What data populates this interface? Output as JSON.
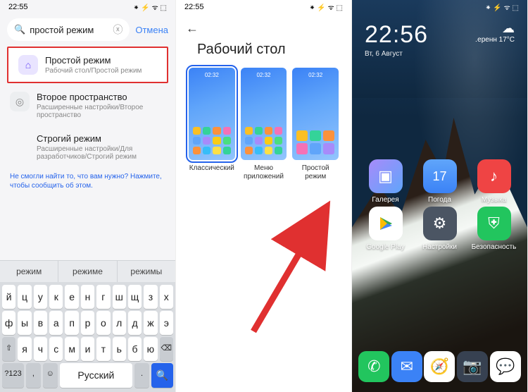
{
  "status": {
    "time": "22:55",
    "icons": "⁕ ⚡ ᯤ ⬚"
  },
  "screen1": {
    "search": {
      "icon": "🔍",
      "query": "простой режим",
      "clear": "ⓧ"
    },
    "cancel": "Отмена",
    "results": [
      {
        "icon": "⌂",
        "title": "Простой режим",
        "sub": "Рабочий стол/Простой режим"
      },
      {
        "icon": "◎",
        "title": "Второе пространство",
        "sub": "Расширенные настройки/Второе пространство"
      },
      {
        "icon": "",
        "title": "Строгий режим",
        "sub": "Расширенные настройки/Для разработчиков/Строгий режим"
      }
    ],
    "help": "Не смогли найти то, что вам нужно? Нажмите, чтобы сообщить об этом.",
    "suggestions": [
      "режим",
      "режиме",
      "режимы"
    ],
    "kbd": {
      "r1": [
        "й",
        "ц",
        "у",
        "к",
        "е",
        "н",
        "г",
        "ш",
        "щ",
        "з",
        "х"
      ],
      "r2": [
        "ф",
        "ы",
        "в",
        "а",
        "п",
        "р",
        "о",
        "л",
        "д",
        "ж",
        "э"
      ],
      "r3_shift": "⇧",
      "r3": [
        "я",
        "ч",
        "с",
        "м",
        "и",
        "т",
        "ь",
        "б",
        "ю"
      ],
      "r3_del": "⌫",
      "r4": {
        "sym": "?123",
        "comma": ",",
        "emoji": "☺",
        "lang": "Русский",
        "dot": ".",
        "search": "🔍"
      }
    }
  },
  "screen2": {
    "back": "←",
    "title": "Рабочий стол",
    "preview_time": "02:32",
    "options": [
      {
        "label": "Классический"
      },
      {
        "label": "Меню приложений"
      },
      {
        "label": "Простой режим"
      }
    ],
    "icon_colors": [
      "#fbbf24",
      "#34d399",
      "#fb923c",
      "#f472b6",
      "#60a5fa",
      "#a78bfa",
      "#facc15",
      "#4ade80",
      "#fb923c",
      "#38bdf8",
      "#fde047",
      "#34d399"
    ]
  },
  "screen3": {
    "clock": "22:56",
    "date": "Вт, 6 Август",
    "weather": {
      "icon": "☁",
      "text": "․еренн",
      "temp": "17°C"
    },
    "apps": [
      {
        "label": "Галерея",
        "cls": "ic-gallery",
        "glyph": "▣"
      },
      {
        "label": "Погода",
        "cls": "ic-weather",
        "glyph": "17"
      },
      {
        "label": "Музыка",
        "cls": "ic-music",
        "glyph": "♪"
      },
      {
        "label": "Google Play",
        "cls": "ic-play",
        "glyph": "▶"
      },
      {
        "label": "Настройки",
        "cls": "ic-settings",
        "glyph": "⚙"
      },
      {
        "label": "Безопасность",
        "cls": "ic-security",
        "glyph": "⛨"
      }
    ],
    "dock": [
      {
        "cls": "ic-phone",
        "glyph": "✆"
      },
      {
        "cls": "ic-sms",
        "glyph": "✉"
      },
      {
        "cls": "ic-browser",
        "glyph": "🧭"
      },
      {
        "cls": "ic-camera",
        "glyph": "📷"
      },
      {
        "cls": "ic-msgs",
        "glyph": "💬"
      }
    ]
  }
}
